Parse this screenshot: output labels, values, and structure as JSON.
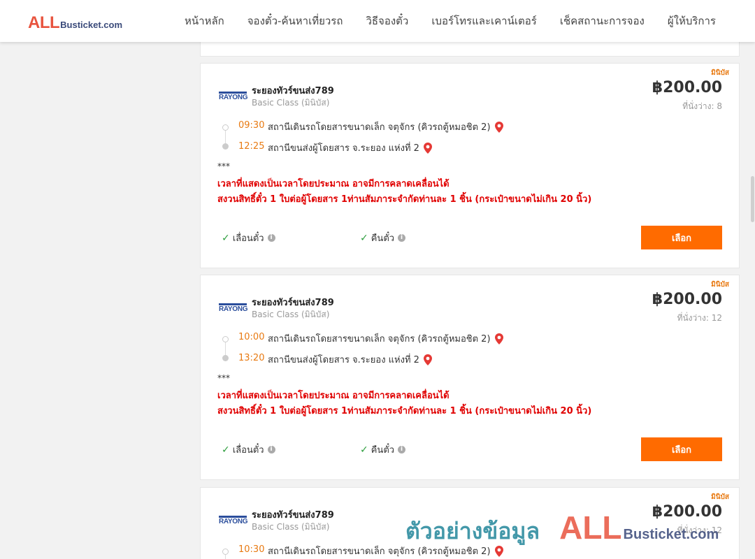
{
  "header": {
    "logo_all": "ALL",
    "logo_rest": "Busticket.com",
    "nav": [
      "หน้าหลัก",
      "จองตั๋ว-ค้นหาเที่ยวรถ",
      "วิธีจองตั๋ว",
      "เบอร์โทรและเคาน์เตอร์",
      "เช็คสถานะการจอง",
      "ผู้ให้บริการ"
    ]
  },
  "trips": [
    {
      "badge": "มินิบัส",
      "operator_logo": "RAYONG",
      "operator": "ระยองทัวร์ขนส่ง789",
      "bus_class": "Basic Class (มินิบัส)",
      "price": "฿200.00",
      "seats": "ที่นั่งว่าง: 8",
      "depart_time": "09:30",
      "depart_station": "สถานีเดินรถโดยสารขนาดเล็ก จตุจักร (คิวรถตู้หมอชิต 2)",
      "arrive_time": "12:25",
      "arrive_station": "สถานีขนส่งผู้โดยสาร จ.ระยอง แห่งที่ 2",
      "note_stars": "***",
      "note_line1": "เวลาที่แสดงเป็นเวลาโดยประมาณ อาจมีการคลาดเคลื่อนได้",
      "note_line2": "สงวนสิทธิ์ตั๋ว 1 ใบต่อผู้โดยสาร 1ท่านสัมภาระจำกัดท่านละ 1 ชิ้น (กระเป๋าขนาดไม่เกิน 20 นิ้ว)",
      "feature1": "เลื่อนตั๋ว",
      "feature2": "คืนตั๋ว",
      "button": "เลือก"
    },
    {
      "badge": "มินิบัส",
      "operator_logo": "RAYONG",
      "operator": "ระยองทัวร์ขนส่ง789",
      "bus_class": "Basic Class (มินิบัส)",
      "price": "฿200.00",
      "seats": "ที่นั่งว่าง: 12",
      "depart_time": "10:00",
      "depart_station": "สถานีเดินรถโดยสารขนาดเล็ก จตุจักร (คิวรถตู้หมอชิต 2)",
      "arrive_time": "13:20",
      "arrive_station": "สถานีขนส่งผู้โดยสาร จ.ระยอง แห่งที่ 2",
      "note_stars": "***",
      "note_line1": "เวลาที่แสดงเป็นเวลาโดยประมาณ อาจมีการคลาดเคลื่อนได้",
      "note_line2": "สงวนสิทธิ์ตั๋ว 1 ใบต่อผู้โดยสาร 1ท่านสัมภาระจำกัดท่านละ 1 ชิ้น (กระเป๋าขนาดไม่เกิน 20 นิ้ว)",
      "feature1": "เลื่อนตั๋ว",
      "feature2": "คืนตั๋ว",
      "button": "เลือก"
    },
    {
      "badge": "มินิบัส",
      "operator_logo": "RAYONG",
      "operator": "ระยองทัวร์ขนส่ง789",
      "bus_class": "Basic Class (มินิบัส)",
      "price": "฿200.00",
      "seats": "ที่นั่งว่าง: 12",
      "depart_time": "10:30",
      "depart_station": "สถานีเดินรถโดยสารขนาดเล็ก จตุจักร (คิวรถตู้หมอชิต 2)"
    }
  ],
  "watermark": {
    "thai": "ตัวอย่างข้อมูล",
    "all": "ALL",
    "rest": "Busticket.com"
  },
  "colors": {
    "accent": "#ff6b00",
    "time": "#e87a12",
    "note": "#e00000",
    "check": "#2e9e3e",
    "pin": "#e53935"
  },
  "icons": [
    "map-pin-icon",
    "check-icon",
    "info-icon"
  ]
}
